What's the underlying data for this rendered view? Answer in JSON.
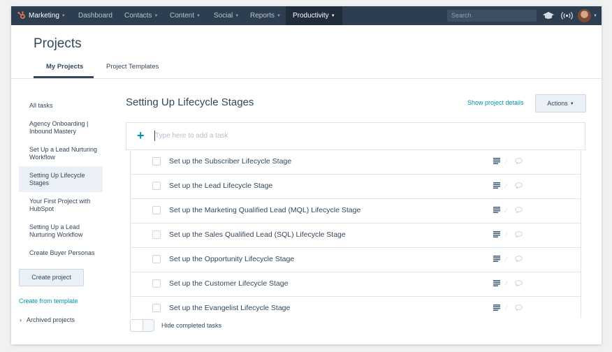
{
  "nav": {
    "brand": "Marketing",
    "items": [
      {
        "label": "Dashboard",
        "has_caret": false
      },
      {
        "label": "Contacts",
        "has_caret": true
      },
      {
        "label": "Content",
        "has_caret": true
      },
      {
        "label": "Social",
        "has_caret": true
      },
      {
        "label": "Reports",
        "has_caret": true
      },
      {
        "label": "Productivity",
        "has_caret": true
      }
    ],
    "active_item": "Productivity",
    "search_placeholder": "Search",
    "icons": [
      "graduation-cap-icon",
      "broadcast-icon",
      "user-avatar",
      "chevron-down-icon"
    ],
    "colors": {
      "bar": "#2d3e50",
      "brand_orange": "#ff7a59"
    }
  },
  "header": {
    "title": "Projects",
    "tabs": [
      {
        "label": "My Projects",
        "active": true
      },
      {
        "label": "Project Templates",
        "active": false
      }
    ]
  },
  "sidebar": {
    "items": [
      {
        "label": "All tasks"
      },
      {
        "label": "Agency Onboarding | Inbound Mastery"
      },
      {
        "label": "Set Up a Lead Nurturing Workflow"
      },
      {
        "label": "Setting Up Lifecycle Stages",
        "active": true
      },
      {
        "label": "Your First Project with HubSpot"
      },
      {
        "label": "Setting Up a Lead Nurturing Workflow"
      },
      {
        "label": "Create Buyer Personas"
      }
    ],
    "create_button": "Create project",
    "template_link": "Create from template",
    "archived_label": "Archived projects"
  },
  "main": {
    "title": "Setting Up Lifecycle Stages",
    "show_details": "Show project details",
    "actions_label": "Actions",
    "add_task_placeholder": "Type here to add a task",
    "tasks": [
      {
        "label": "Set up the Subscriber Lifecycle Stage",
        "done": false
      },
      {
        "label": "Set up the Lead Lifecycle Stage",
        "done": false
      },
      {
        "label": "Set up the Marketing Qualified Lead (MQL) Lifecycle Stage",
        "done": false
      },
      {
        "label": "Set up the Sales Qualified Lead (SQL) Lifecycle Stage",
        "done": false
      },
      {
        "label": "Set up the Opportunity Lifecycle Stage",
        "done": false
      },
      {
        "label": "Set up the Customer Lifecycle Stage",
        "done": false
      },
      {
        "label": "Set up the Evangelist Lifecycle Stage",
        "done": false
      }
    ],
    "hide_completed_label": "Hide completed tasks",
    "hide_completed_on": false,
    "colors": {
      "link": "#0091ae",
      "text": "#33475b"
    }
  }
}
